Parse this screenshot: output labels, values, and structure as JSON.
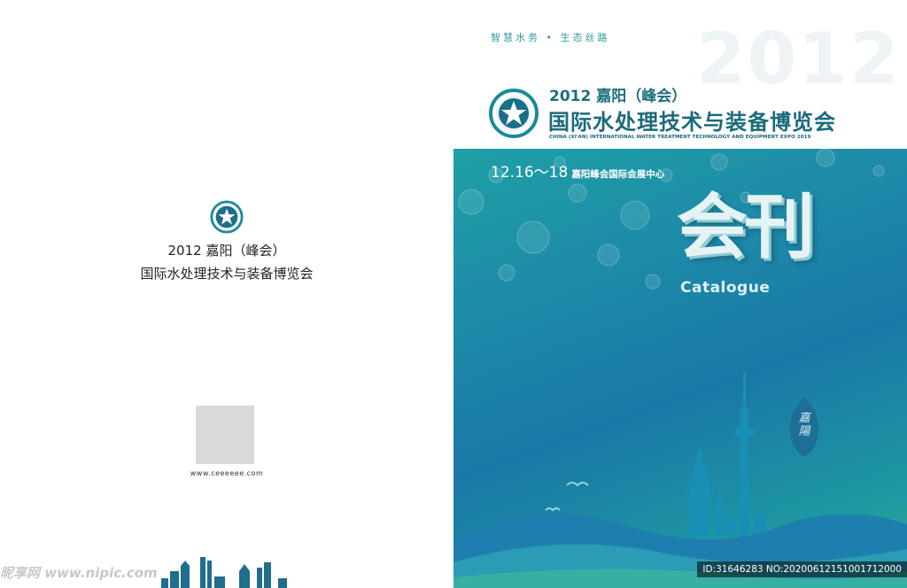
{
  "left_page": {
    "title_line1": "2012 嘉阳（峰会）",
    "title_line2": "国际水处理技术与装备博览会",
    "qr_url": "www.ceeeeee.com"
  },
  "right_page": {
    "slogan": "智慧水务 • 生态丝路",
    "year_background": "2012",
    "title_line1": "2012 嘉阳（峰会）",
    "title_line2": "国际水处理技术与装备博览会",
    "title_en": "CHINA (XI'AN) INTERNATIONAL WATER TREATMENT TECHNOLOGY AND EQUIPMENT EXPO 2019",
    "date_range": "12.16～18",
    "venue": "嘉阳峰会国际会展中心",
    "main_title": "会刊",
    "subtitle": "Catalogue",
    "seal_text": "嘉陽"
  },
  "watermark": {
    "site": "昵享网 www.nipic.com",
    "id_text": "ID:31646283 NO:20200612151001712000"
  },
  "colors": {
    "brand_teal": "#1b6a7c",
    "gradient_top": "#1fa0a6",
    "gradient_mid": "#1a78a8",
    "gradient_bottom": "#3bb08e"
  },
  "icons": [
    "star-logo-icon",
    "skyline-icon",
    "seal-icon"
  ]
}
